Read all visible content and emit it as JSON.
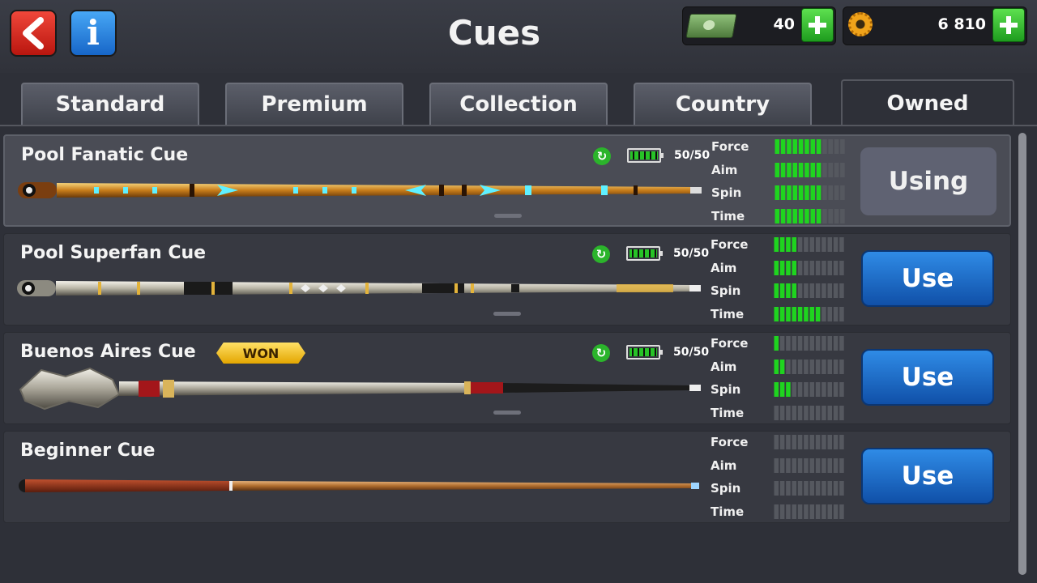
{
  "header": {
    "title": "Cues",
    "cash_value": "40",
    "coins_value": "6 810"
  },
  "tabs": [
    "Standard",
    "Premium",
    "Collection",
    "Country",
    "Owned"
  ],
  "active_tab": "Owned",
  "cues": [
    {
      "name": "Pool Fanatic Cue",
      "won_badge": "",
      "battery": "50/50",
      "stats": {
        "Force": 8,
        "Aim": 8,
        "Spin": 8,
        "Time": 8
      },
      "button": "Using"
    },
    {
      "name": "Pool Superfan Cue",
      "won_badge": "",
      "battery": "50/50",
      "stats": {
        "Force": 4,
        "Aim": 4,
        "Spin": 4,
        "Time": 8
      },
      "button": "Use"
    },
    {
      "name": "Buenos Aires Cue",
      "won_badge": "WON",
      "battery": "50/50",
      "stats": {
        "Force": 1,
        "Aim": 2,
        "Spin": 3,
        "Time": 0
      },
      "button": "Use"
    },
    {
      "name": "Beginner Cue",
      "won_badge": "",
      "battery": "",
      "stats": {
        "Force": 0,
        "Aim": 0,
        "Spin": 0,
        "Time": 0
      },
      "button": "Use"
    }
  ],
  "stat_labels": [
    "Force",
    "Aim",
    "Spin",
    "Time"
  ],
  "stat_max": 12,
  "colors": {
    "stat_fill": "#1fd41f",
    "stat_empty": "#55585f",
    "use_button": "#1f6fd0",
    "accent_green": "#2bb42b"
  },
  "icons": {
    "back": "back-arrow-icon",
    "info": "info-icon",
    "cash": "cash-icon",
    "coins": "coin-gear-icon",
    "add": "plus-icon",
    "refresh": "refresh-icon",
    "battery": "battery-icon"
  }
}
